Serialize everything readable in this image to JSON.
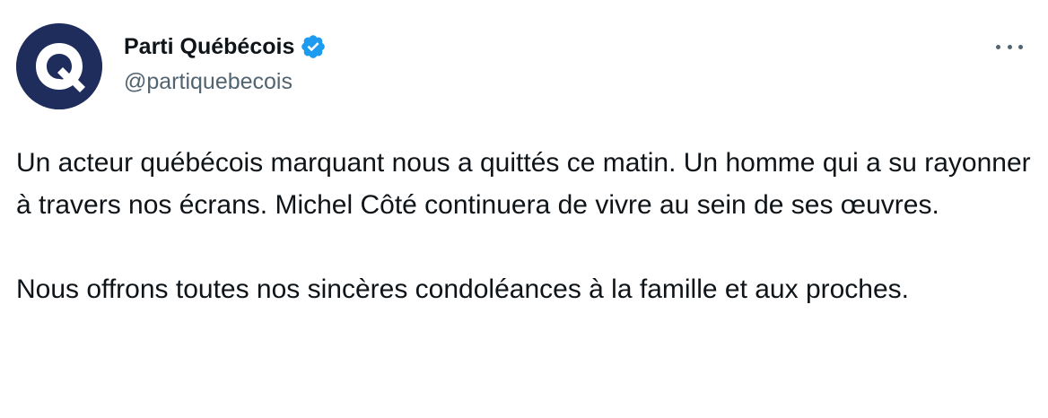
{
  "account": {
    "display_name": "Parti Québécois",
    "handle": "@partiquebecois",
    "verified_icon": "verified-badge-icon",
    "avatar_icon": "parti-quebecois-logo"
  },
  "menu": {
    "icon": "more-options-icon"
  },
  "tweet": {
    "paragraphs": [
      "Un acteur québécois marquant nous a quittés ce matin. Un homme qui a su rayonner à travers nos écrans. Michel Côté continuera de vivre au sein de ses œuvres.",
      "Nous offrons toutes nos sincères condoléances à la famille et aux proches."
    ]
  },
  "colors": {
    "text_primary": "#0f1419",
    "text_secondary": "#536471",
    "verified_blue": "#1d9bf0",
    "avatar_bg": "#1f2d5c"
  }
}
